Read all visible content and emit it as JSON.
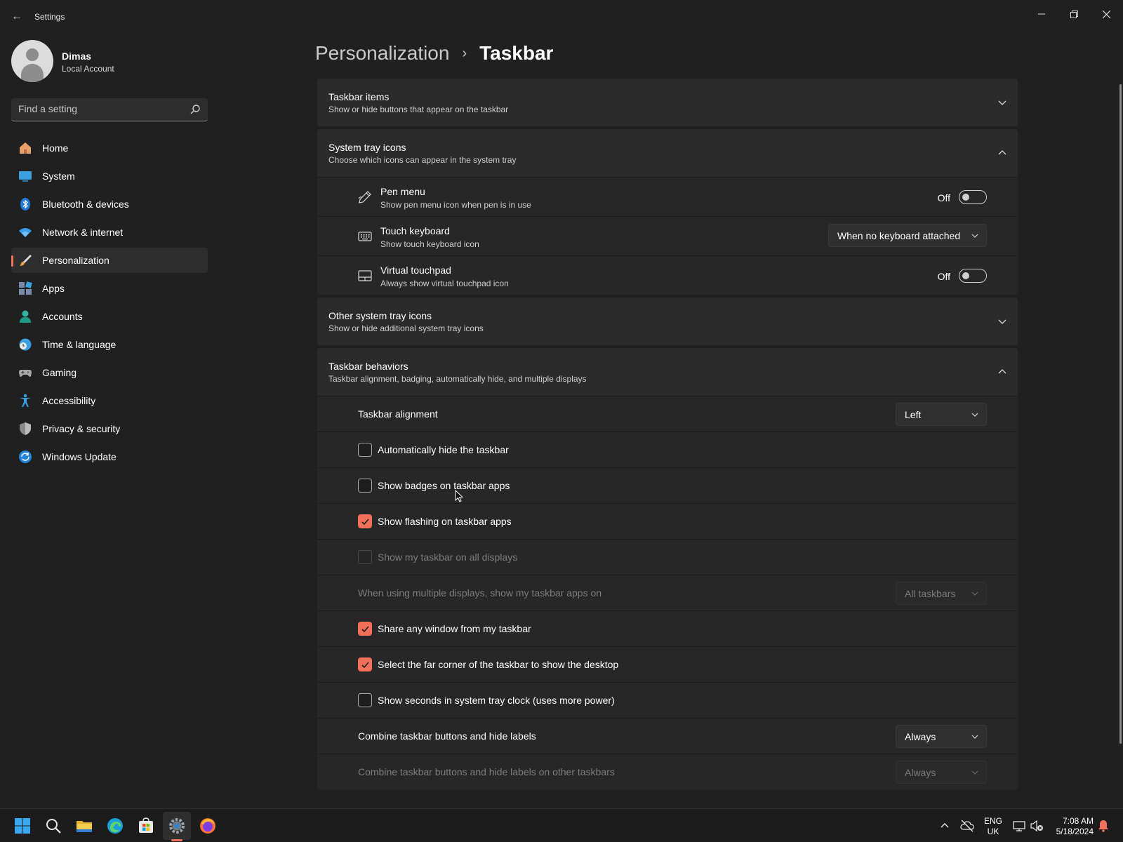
{
  "window": {
    "app_title": "Settings",
    "back_glyph": "←",
    "controls": [
      "minimize",
      "restore",
      "close"
    ]
  },
  "user": {
    "name": "Dimas",
    "account_type": "Local Account"
  },
  "search": {
    "placeholder": "Find a setting"
  },
  "sidebar": {
    "items": [
      {
        "label": "Home",
        "icon": "home-icon",
        "active": false
      },
      {
        "label": "System",
        "icon": "system-icon",
        "active": false
      },
      {
        "label": "Bluetooth & devices",
        "icon": "bluetooth-icon",
        "active": false
      },
      {
        "label": "Network & internet",
        "icon": "wifi-icon",
        "active": false
      },
      {
        "label": "Personalization",
        "icon": "brush-icon",
        "active": true
      },
      {
        "label": "Apps",
        "icon": "apps-icon",
        "active": false
      },
      {
        "label": "Accounts",
        "icon": "person-icon",
        "active": false
      },
      {
        "label": "Time & language",
        "icon": "clock-globe-icon",
        "active": false
      },
      {
        "label": "Gaming",
        "icon": "gamepad-icon",
        "active": false
      },
      {
        "label": "Accessibility",
        "icon": "accessibility-icon",
        "active": false
      },
      {
        "label": "Privacy & security",
        "icon": "shield-icon",
        "active": false
      },
      {
        "label": "Windows Update",
        "icon": "update-icon",
        "active": false
      }
    ]
  },
  "breadcrumb": {
    "parent": "Personalization",
    "separator": "›",
    "current": "Taskbar"
  },
  "sections": {
    "taskbar_items": {
      "title": "Taskbar items",
      "subtitle": "Show or hide buttons that appear on the taskbar",
      "expanded": false
    },
    "system_tray": {
      "title": "System tray icons",
      "subtitle": "Choose which icons can appear in the system tray",
      "expanded": true,
      "rows": [
        {
          "title": "Pen menu",
          "subtitle": "Show pen menu icon when pen is in use",
          "control": "toggle",
          "state_label": "Off",
          "icon": "pen-icon"
        },
        {
          "title": "Touch keyboard",
          "subtitle": "Show touch keyboard icon",
          "control": "dropdown",
          "value": "When no keyboard attached",
          "icon": "keyboard-icon"
        },
        {
          "title": "Virtual touchpad",
          "subtitle": "Always show virtual touchpad icon",
          "control": "toggle",
          "state_label": "Off",
          "icon": "touchpad-icon"
        }
      ]
    },
    "other_tray": {
      "title": "Other system tray icons",
      "subtitle": "Show or hide additional system tray icons",
      "expanded": false
    },
    "behaviors": {
      "title": "Taskbar behaviors",
      "subtitle": "Taskbar alignment, badging, automatically hide, and multiple displays",
      "expanded": true,
      "alignment": {
        "label": "Taskbar alignment",
        "value": "Left"
      },
      "checkboxes": [
        {
          "label": "Automatically hide the taskbar",
          "checked": false,
          "disabled": false
        },
        {
          "label": "Show badges on taskbar apps",
          "checked": false,
          "disabled": false
        },
        {
          "label": "Show flashing on taskbar apps",
          "checked": true,
          "disabled": false
        },
        {
          "label": "Show my taskbar on all displays",
          "checked": false,
          "disabled": true
        }
      ],
      "multi_display": {
        "label": "When using multiple displays, show my taskbar apps on",
        "value": "All taskbars",
        "disabled": true
      },
      "checkboxes2": [
        {
          "label": "Share any window from my taskbar",
          "checked": true,
          "disabled": false
        },
        {
          "label": "Select the far corner of the taskbar to show the desktop",
          "checked": true,
          "disabled": false
        },
        {
          "label": "Show seconds in system tray clock (uses more power)",
          "checked": false,
          "disabled": false
        }
      ],
      "combine": {
        "label": "Combine taskbar buttons and hide labels",
        "value": "Always"
      },
      "combine_other": {
        "label": "Combine taskbar buttons and hide labels on other taskbars",
        "value": "Always",
        "disabled": true
      }
    }
  },
  "taskbar": {
    "apps": [
      "start-icon",
      "search-icon",
      "file-explorer-icon",
      "edge-icon",
      "store-icon",
      "settings-icon",
      "firefox-icon"
    ],
    "language_line1": "ENG",
    "language_line2": "UK",
    "time": "7:08 AM",
    "date": "5/18/2024"
  },
  "colors": {
    "accent": "#f0705a",
    "background": "#202020",
    "card": "#2b2b2b"
  }
}
